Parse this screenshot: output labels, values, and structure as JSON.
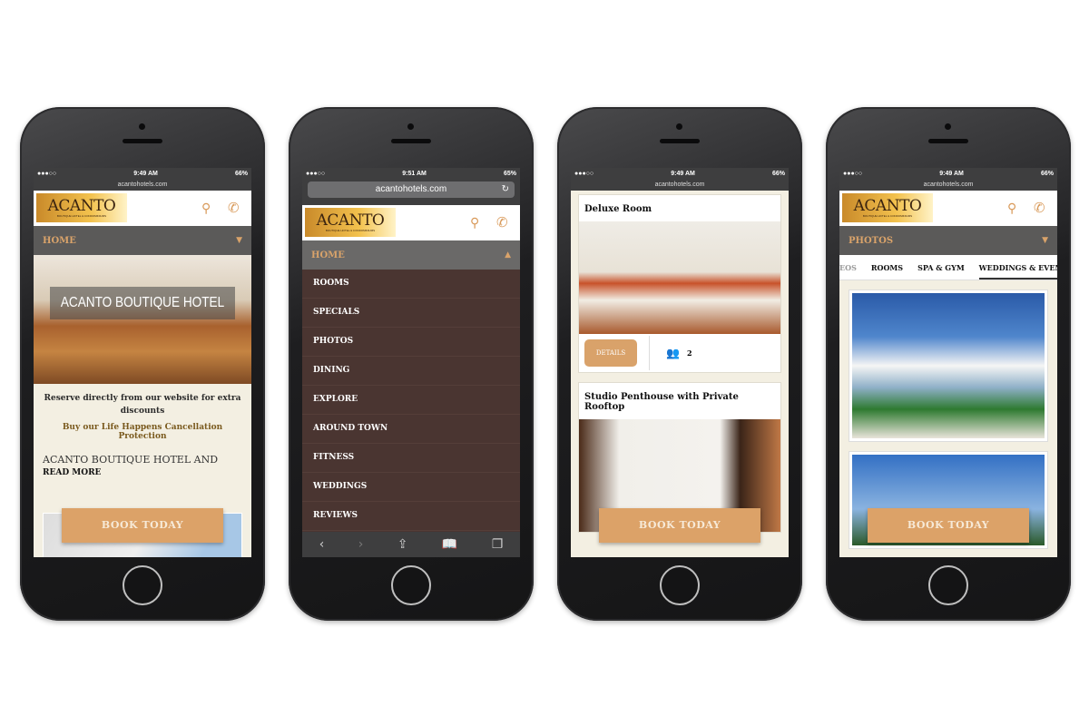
{
  "colors": {
    "accent": "#dca268",
    "nav_bg": "#5b5a59",
    "menu_bg": "#4a3531",
    "page_bg": "#f3efe2"
  },
  "logo": {
    "brand": "ACANTO",
    "tagline": "BOUTIQUE HOTEL & CONDOMINIUMS"
  },
  "icons": {
    "pin": "map-pin-icon",
    "phone": "phone-icon"
  },
  "phones": [
    {
      "status": {
        "signal": "●●●○○",
        "time": "9:49 AM",
        "battery": "66%"
      },
      "url": "acantohotels.com",
      "nav": "HOME",
      "hero_title": "ACANTO BOUTIQUE HOTEL",
      "reserve": "Reserve directly from our website for extra discounts",
      "protection": "Buy our Life Happens Cancellation Protection",
      "intro": "ACANTO BOUTIQUE HOTEL AND",
      "read_more": "READ MORE",
      "book": "BOOK TODAY"
    },
    {
      "status": {
        "signal": "●●●○○",
        "time": "9:51 AM",
        "battery": "65%"
      },
      "url": "acantohotels.com",
      "nav": "HOME",
      "menu": [
        "ROOMS",
        "SPECIALS",
        "PHOTOS",
        "DINING",
        "EXPLORE",
        "AROUND TOWN",
        "FITNESS",
        "WEDDINGS",
        "REVIEWS"
      ]
    },
    {
      "status": {
        "signal": "●●●○○",
        "time": "9:49 AM",
        "battery": "66%"
      },
      "url": "acantohotels.com",
      "rooms": [
        {
          "name": "Deluxe Room",
          "details": "DETAILS",
          "guests": "2"
        },
        {
          "name": "Studio Penthouse with Private Rooftop"
        }
      ],
      "book": "BOOK TODAY"
    },
    {
      "status": {
        "signal": "●●●○○",
        "time": "9:49 AM",
        "battery": "66%"
      },
      "url": "acantohotels.com",
      "nav": "PHOTOS",
      "tabs": [
        "EOS",
        "ROOMS",
        "SPA & GYM",
        "WEDDINGS & EVEN"
      ],
      "active_tab": "WEDDINGS & EVEN",
      "book": "BOOK TODAY"
    }
  ]
}
